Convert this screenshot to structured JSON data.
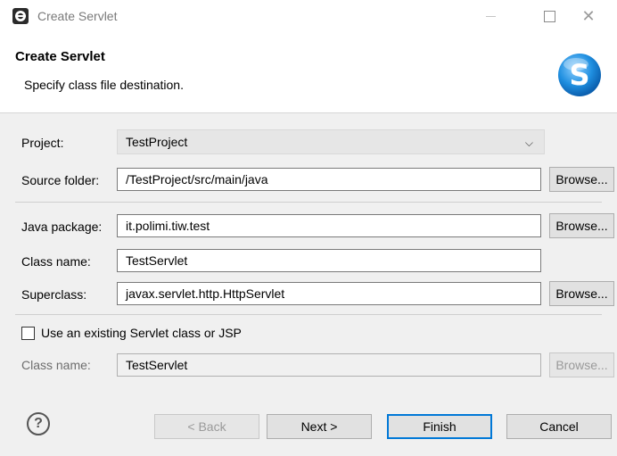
{
  "window": {
    "title": "Create Servlet",
    "minimize_icon": "minimize-icon",
    "maximize_icon": "maximize-icon",
    "close_icon": "close-icon",
    "close_glyph": "✕"
  },
  "banner": {
    "title": "Create Servlet",
    "subtitle": "Specify class file destination.",
    "logo_letter": "S",
    "logo_icon": "servlet-logo-icon"
  },
  "form": {
    "project": {
      "label": "Project:",
      "value": "TestProject",
      "chevron": "⌵"
    },
    "source_folder": {
      "label": "Source folder:",
      "value": "/TestProject/src/main/java",
      "browse": "Browse..."
    },
    "java_package": {
      "label": "Java package:",
      "value": "it.polimi.tiw.test",
      "browse": "Browse..."
    },
    "class_name": {
      "label": "Class name:",
      "value": "TestServlet"
    },
    "superclass": {
      "label": "Superclass:",
      "value": "javax.servlet.http.HttpServlet",
      "browse": "Browse..."
    },
    "use_existing": {
      "label": "Use an existing Servlet class or JSP",
      "checked": false
    },
    "existing_class_name": {
      "label": "Class name:",
      "value": "TestServlet",
      "browse": "Browse..."
    }
  },
  "footer": {
    "help_glyph": "?",
    "back": "< Back",
    "next": "Next >",
    "finish": "Finish",
    "cancel": "Cancel"
  },
  "colors": {
    "accent": "#0078d7",
    "logo_blue": "#1f8fe0",
    "dialog_bg": "#f0f0f0"
  }
}
